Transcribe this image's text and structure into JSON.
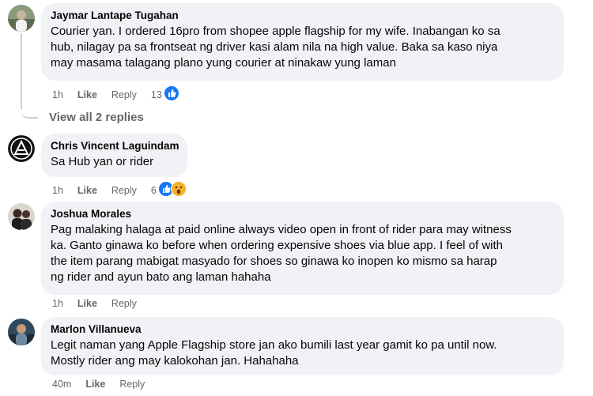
{
  "comments": [
    {
      "author": "Jaymar Lantape Tugahan",
      "lines": [
        "Courier yan. I ordered 16pro from shopee apple flagship for my wife. Inabangan ko sa",
        "hub, nilagay pa sa frontseat ng driver kasi alam nila na high value. Baka sa kaso niya",
        "may masama talagang plano yung courier at ninakaw yung laman"
      ],
      "time": "1h",
      "like": "Like",
      "reply": "Reply",
      "reaction_count": "13",
      "reactions": [
        "like"
      ]
    },
    {
      "author": "Chris Vincent Laguindam",
      "lines": [
        "Sa Hub yan or rider"
      ],
      "time": "1h",
      "like": "Like",
      "reply": "Reply",
      "reaction_count": "6",
      "reactions": [
        "like",
        "wow"
      ]
    },
    {
      "author": "Joshua Morales",
      "lines": [
        "Pag malaking halaga at paid online always video open in front of rider para may witness",
        "ka. Ganto ginawa ko before when ordering expensive shoes via blue app. I feel of with",
        "the item parang mabigat masyado for shoes so ginawa ko inopen ko mismo sa harap",
        "ng rider and ayun bato ang laman hahaha"
      ],
      "time": "1h",
      "like": "Like",
      "reply": "Reply"
    },
    {
      "author": "Marlon Villanueva",
      "lines": [
        "Legit naman yang Apple Flagship store jan ako bumili last year gamit ko pa until now.",
        "Mostly rider ang may kalokohan jan. Hahahaha"
      ],
      "time": "40m",
      "like": "Like",
      "reply": "Reply"
    }
  ],
  "view_replies": "View all 2 replies",
  "colors": {
    "bubble": "#f0f2f5",
    "meta_text": "#65676b",
    "like_blue": "#1877f2",
    "wow_yellow": "#f7b125",
    "thread_line": "#ced0d4"
  }
}
